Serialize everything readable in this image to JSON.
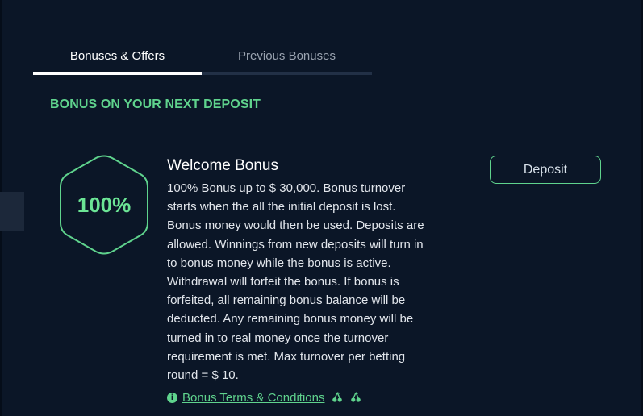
{
  "tabs": {
    "active": "Bonuses & Offers",
    "inactive": "Previous Bonuses"
  },
  "section": {
    "title": "BONUS ON YOUR NEXT DEPOSIT"
  },
  "bonus": {
    "badge_value": "100%",
    "title": "Welcome Bonus",
    "description": "100% Bonus up to $ 30,000. Bonus turnover\nstarts when the all the initial deposit is lost.\nBonus money would then be used. Deposits are\nallowed. Winnings from new deposits will turn in\nto bonus money while the bonus is active.\nWithdrawal will forfeit the bonus. If bonus is\nforfeited, all remaining bonus balance will be\ndeducted. Any remaining bonus money will be\nturned in to real money once the turnover\nrequirement is met. Max turnover per betting\nround = $ 10.",
    "deposit_label": "Deposit",
    "terms_label": "Bonus Terms & Conditions",
    "info_icon": "i"
  },
  "icons": {
    "info": "info-icon",
    "cherry": "cherry-icon",
    "hexagon": "hexagon-badge"
  },
  "colors": {
    "background": "#0b1627",
    "accent": "#5fd38d",
    "badge_text": "#6be495",
    "text_primary": "#ffffff",
    "text_secondary": "#9aa3b0"
  }
}
